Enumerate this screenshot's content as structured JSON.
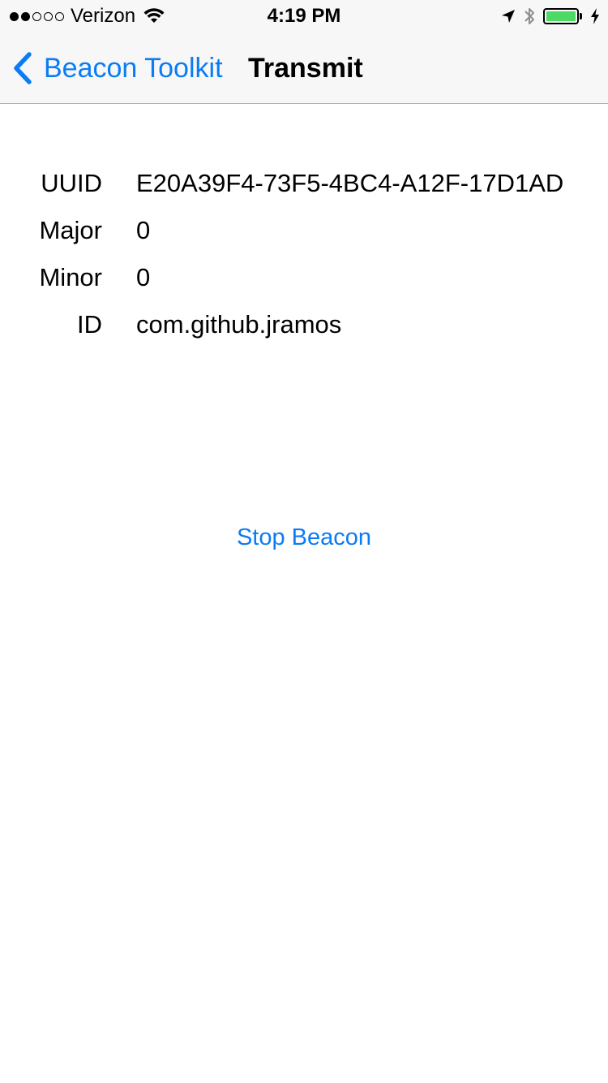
{
  "status_bar": {
    "carrier": "Verizon",
    "time": "4:19 PM",
    "signal_dots_filled": 2,
    "signal_dots_total": 5,
    "battery_level": 1.0,
    "battery_color": "#4cd964",
    "icons": [
      "wifi-icon",
      "location-arrow-icon",
      "bluetooth-icon",
      "battery-icon",
      "charging-bolt-icon"
    ]
  },
  "nav": {
    "back_label": "Beacon Toolkit",
    "title": "Transmit",
    "accent_color": "#0a7cf5"
  },
  "beacon_info": {
    "rows": [
      {
        "label": "UUID",
        "value": "E20A39F4-73F5-4BC4-A12F-17D1AD"
      },
      {
        "label": "Major",
        "value": "0"
      },
      {
        "label": "Minor",
        "value": "0"
      },
      {
        "label": "ID",
        "value": "com.github.jramos"
      }
    ]
  },
  "actions": {
    "stop_label": "Stop Beacon"
  }
}
